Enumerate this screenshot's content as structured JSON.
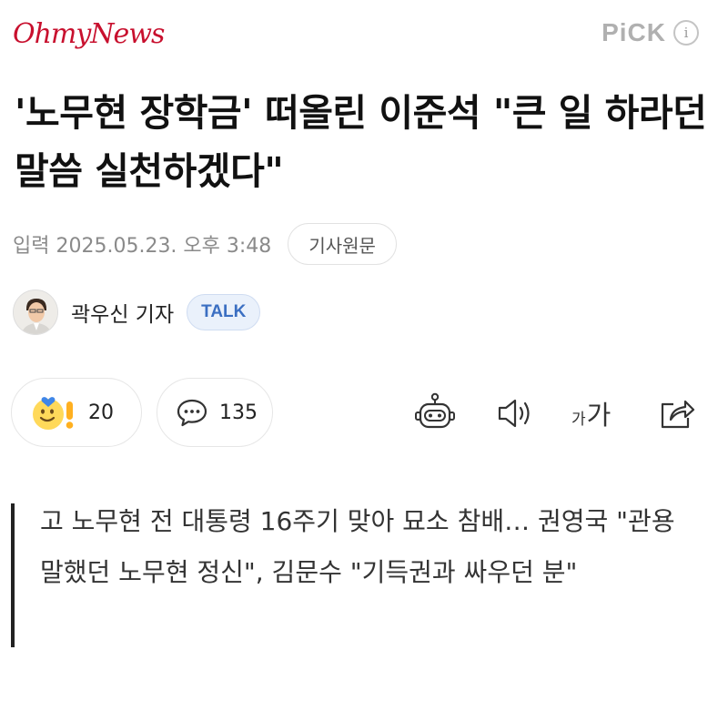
{
  "header": {
    "logo": "OhmyNews",
    "pick_label": "PiCK",
    "info_glyph": "i"
  },
  "article": {
    "headline": "'노무현 장학금' 떠올린 이준석 \"큰 일 하라던 말씀 실천하겠다\"",
    "dateline": "입력 2025.05.23. 오후 3:48",
    "original_button": "기사원문",
    "author": "곽우신 기자",
    "talk_badge": "TALK",
    "summary": "고 노무현 전 대통령 16주기 맞아 묘소 참배… 권영국 \"관용 말했던 노무현 정신\", 김문수 \"기득권과 싸우던 분\""
  },
  "actions": {
    "reactions_count": "20",
    "comments_count": "135",
    "font_small_glyph": "가",
    "font_large_glyph": "가"
  },
  "colors": {
    "logo": "#c8102e",
    "talk_badge_text": "#3b6fc2",
    "talk_badge_bg": "#eaf1fb",
    "emoji_yellow": "#ffd95a",
    "emoji_blue": "#3f86e8",
    "summary_bar": "#222222"
  },
  "icons": {
    "reaction": "smiley-exclamation-icon",
    "comment": "speech-bubble-icon",
    "ai_summary": "robot-icon",
    "listen": "speaker-icon",
    "font_size": "font-size-icon",
    "share": "share-icon",
    "info": "info-icon"
  }
}
